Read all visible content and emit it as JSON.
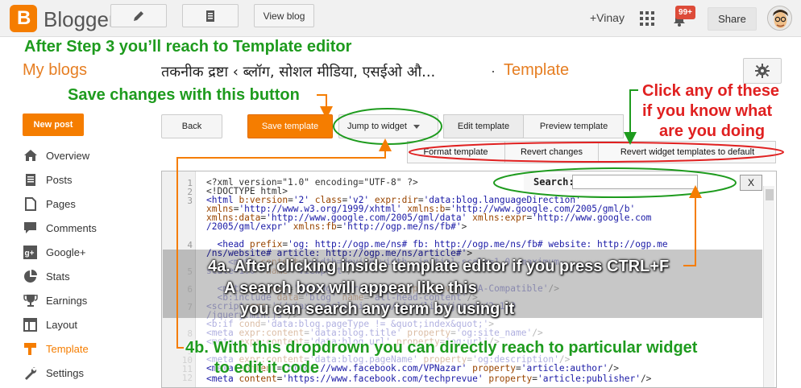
{
  "topbar": {
    "logo_letter": "B",
    "brand": "Blogger",
    "view_blog": "View blog",
    "account": "+Vinay",
    "notif_count": "99+",
    "share": "Share"
  },
  "annotations": {
    "step3": "After Step 3 you’ll reach to Template editor",
    "save_changes": "Save changes with this button",
    "click_any": [
      "Click any of these",
      "if you know what",
      "are you doing"
    ],
    "note_4a": [
      "4a. After clicking inside template editor if you press CTRL+F",
      "A search box will appear like this",
      "you can search any term by using it"
    ],
    "note_4b": [
      "4b. With this dropdrown you can directly reach to particular widget",
      "to edit it code"
    ]
  },
  "header": {
    "my_blogs": "My blogs",
    "blog_title": "तकनीक द्रष्टा ‹ ब्लॉग, सोशल मीडिया, एसईओ औ...",
    "separator": "·",
    "section": "Template"
  },
  "sidebar": {
    "new_post": "New post",
    "items": [
      {
        "label": "Overview",
        "icon": "home-icon"
      },
      {
        "label": "Posts",
        "icon": "posts-icon"
      },
      {
        "label": "Pages",
        "icon": "pages-icon"
      },
      {
        "label": "Comments",
        "icon": "comments-icon"
      },
      {
        "label": "Google+",
        "icon": "google-plus-icon"
      },
      {
        "label": "Stats",
        "icon": "stats-icon"
      },
      {
        "label": "Earnings",
        "icon": "trophy-icon"
      },
      {
        "label": "Layout",
        "icon": "layout-icon"
      },
      {
        "label": "Template",
        "icon": "template-icon",
        "active": true
      },
      {
        "label": "Settings",
        "icon": "wrench-icon"
      }
    ]
  },
  "toolbar": {
    "back": "Back",
    "save_template": "Save template",
    "jump_to_widget": "Jump to widget",
    "edit_template": "Edit template",
    "preview_template": "Preview template",
    "format_template": "Format template",
    "revert_changes": "Revert changes",
    "revert_widget": "Revert widget templates to default"
  },
  "search": {
    "label": "Search:",
    "value": "",
    "close": "X"
  },
  "editor": {
    "line_numbers": [
      "1",
      "2",
      "3",
      "",
      "",
      "",
      "4",
      "",
      "5",
      "",
      "6",
      "",
      "7",
      "",
      "8",
      "",
      "9",
      "10",
      "11",
      "12",
      "13",
      "14"
    ]
  },
  "colors": {
    "accent": "#f57d00",
    "annotation_green": "#1e9b1e",
    "annotation_red": "#e02020"
  }
}
